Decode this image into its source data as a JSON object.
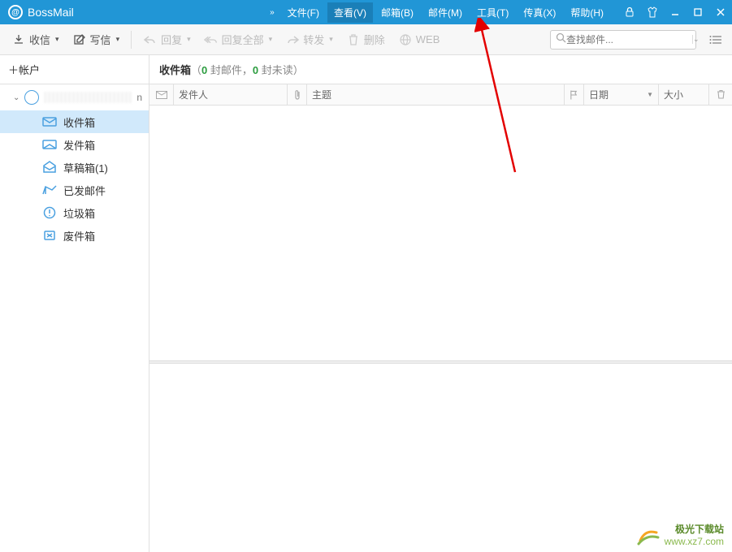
{
  "app": {
    "name": "BossMail"
  },
  "menu": {
    "items": [
      {
        "label": "文件(F)"
      },
      {
        "label": "查看(V)",
        "active": true
      },
      {
        "label": "邮箱(B)"
      },
      {
        "label": "邮件(M)"
      },
      {
        "label": "工具(T)"
      },
      {
        "label": "传真(X)"
      },
      {
        "label": "帮助(H)"
      }
    ]
  },
  "toolbar": {
    "receive": "收信",
    "compose": "写信",
    "reply": "回复",
    "reply_all": "回复全部",
    "forward": "转发",
    "delete": "删除",
    "web": "WEB",
    "search_placeholder": "查找邮件..."
  },
  "sidebar": {
    "header": "＋帐户",
    "account_suffix": "n",
    "folders": [
      {
        "label": "收件箱",
        "icon": "inbox",
        "active": true
      },
      {
        "label": "发件箱",
        "icon": "outbox"
      },
      {
        "label": "草稿箱(1)",
        "icon": "drafts"
      },
      {
        "label": "已发邮件",
        "icon": "sent"
      },
      {
        "label": "垃圾箱",
        "icon": "trash"
      },
      {
        "label": "废件箱",
        "icon": "junk"
      }
    ]
  },
  "main": {
    "inbox_title": "收件箱",
    "stats_open": "（",
    "zero1": "0",
    "stats_mid1": " 封邮件，",
    "zero2": "0",
    "stats_mid2": " 封未读）",
    "columns": {
      "from": "发件人",
      "subject": "主题",
      "date": "日期",
      "size": "大小"
    }
  },
  "watermark": {
    "line1": "极光下载站",
    "line2": "www.xz7.com"
  }
}
